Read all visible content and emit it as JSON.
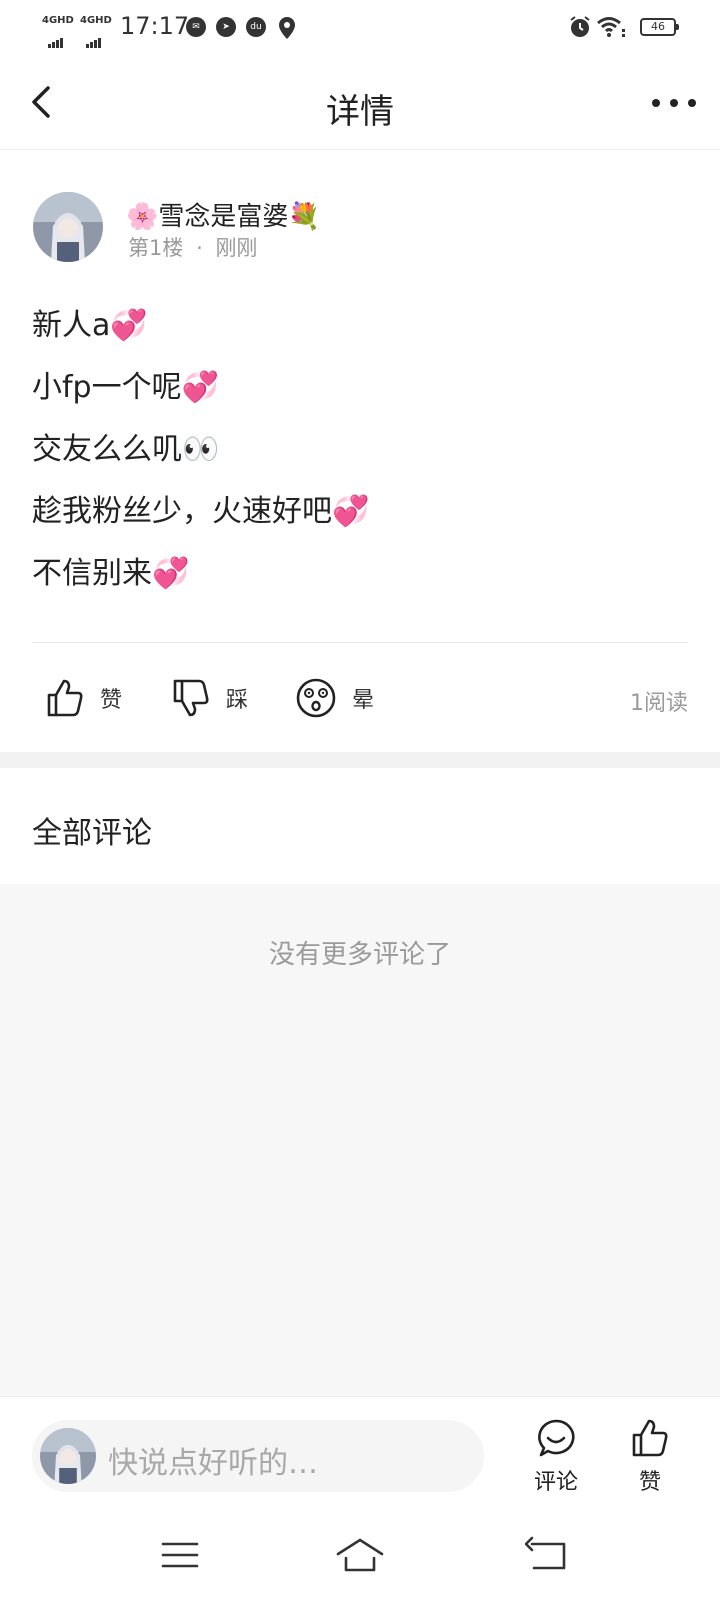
{
  "status_bar": {
    "network_1": "4GHD",
    "network_2": "4GHD",
    "time": "17:17",
    "notification_icons": [
      "wechat-icon",
      "compass-icon",
      "du-app-icon",
      "location-pin-icon"
    ],
    "right_icons": [
      "alarm-icon",
      "wifi-icon",
      "battery-icon"
    ],
    "battery_level": "46"
  },
  "header": {
    "title": "详情",
    "back_icon": "chevron-left-icon",
    "more_icon": "more-dots-icon"
  },
  "post": {
    "username_prefix_emoji": "🌸",
    "username": "雪念是富婆",
    "username_suffix_emoji": "💐",
    "floor": "第1楼",
    "separator": "·",
    "time": "刚刚",
    "lines": [
      "新人a💞",
      "小fp一个呢💞",
      "交友么么叽👀",
      "趁我粉丝少，火速好吧💞",
      "不信别来💞"
    ],
    "actions": [
      {
        "icon": "thumbs-up-icon",
        "label": "赞"
      },
      {
        "icon": "thumbs-down-icon",
        "label": "踩"
      },
      {
        "icon": "dizzy-face-icon",
        "label": "晕"
      }
    ],
    "read_count": "1阅读"
  },
  "comments": {
    "title": "全部评论",
    "empty_text": "没有更多评论了"
  },
  "bottom_bar": {
    "input_placeholder": "快说点好听的…",
    "comment_label": "评论",
    "comment_icon": "comment-bubble-icon",
    "like_label": "赞",
    "like_icon": "thumbs-up-icon"
  },
  "nav_bar": {
    "buttons": [
      "menu-icon",
      "home-icon",
      "back-icon"
    ]
  },
  "colors": {
    "text_primary": "#222222",
    "text_secondary": "#9a9a9a",
    "placeholder": "#a8a8a8",
    "comment_area_bg": "#f7f7f7",
    "divider": "#e8e8e8"
  }
}
